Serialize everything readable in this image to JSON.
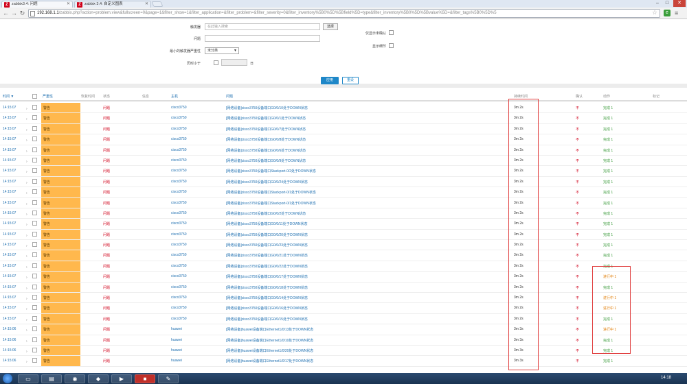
{
  "browser": {
    "tabs": [
      {
        "title": "zabbix3.4: 问题",
        "active": true
      },
      {
        "title": "zabbix 3.4: 自定义图表",
        "active": false
      }
    ],
    "url_host": "192.168.1.1",
    "url_path": "/zabbix.php?action=problem.view&fullscreen=0&page=1&filter_show=1&filter_application=&filter_problem=&filter_severity=0&filter_inventory%5B0%5D%5Bfield%5D=type&filter_inventory%5B0%5D%5Bvalue%5D=&filter_tags%5B0%5D%5"
  },
  "filter": {
    "host_label": "触发器",
    "host_placeholder": "在此输入搜索",
    "select_button": "选择",
    "problem_label": "问题",
    "min_severity_label": "最小的触发器严重性",
    "min_severity_value": "未分类",
    "age_label": "历时小于",
    "age_unit": "日",
    "show_unack_label": "仅显示未确认",
    "show_details_label": "显示细节",
    "apply": "应用",
    "reset": "重设"
  },
  "table": {
    "headers": {
      "time": "时间 ▼",
      "severity": "严重性",
      "recovery": "恢复时间",
      "status": "状态",
      "info": "信息",
      "host": "主机",
      "problem": "问题",
      "duration": "持续时间",
      "ack": "确认",
      "actions": "动作",
      "tags": "标记"
    },
    "rows": [
      {
        "time": "14:15:07",
        "severity": "警告",
        "status": "问题",
        "host": "cisco3750",
        "problem": "[网络设备]cisco3750设备端口G0/0/10处于DOWN状态",
        "duration": "3m 2s",
        "ack": "不",
        "action": "完成 1",
        "warn": false
      },
      {
        "time": "14:15:07",
        "severity": "警告",
        "status": "问题",
        "host": "cisco3750",
        "problem": "[网络设备]cisco3750设备端口G0/0/1处于DOWN状态",
        "duration": "3m 2s",
        "ack": "不",
        "action": "完成 1",
        "warn": false
      },
      {
        "time": "14:15:07",
        "severity": "警告",
        "status": "问题",
        "host": "cisco3750",
        "problem": "[网络设备]cisco3750设备端口G0/0/7处于DOWN状态",
        "duration": "3m 2s",
        "ack": "不",
        "action": "完成 1",
        "warn": false
      },
      {
        "time": "14:15:07",
        "severity": "警告",
        "status": "问题",
        "host": "cisco3750",
        "problem": "[网络设备]cisco3750设备端口G0/0/8处于DOWN状态",
        "duration": "3m 2s",
        "ack": "不",
        "action": "完成 1",
        "warn": false
      },
      {
        "time": "14:15:07",
        "severity": "警告",
        "status": "问题",
        "host": "cisco3750",
        "problem": "[网络设备]cisco3750设备端口G0/0/6处于DOWN状态",
        "duration": "3m 2s",
        "ack": "不",
        "action": "完成 1",
        "warn": false
      },
      {
        "time": "14:15:07",
        "severity": "警告",
        "status": "问题",
        "host": "cisco3750",
        "problem": "[网络设备]cisco3750设备端口G0/0/9处于DOWN状态",
        "duration": "3m 2s",
        "ack": "不",
        "action": "完成 1",
        "warn": false
      },
      {
        "time": "14:15:07",
        "severity": "警告",
        "status": "问题",
        "host": "cisco3750",
        "problem": "[网络设备]cisco3750设备端口Stackport-0/2处于DOWN状态",
        "duration": "3m 2s",
        "ack": "不",
        "action": "完成 1",
        "warn": false
      },
      {
        "time": "14:15:07",
        "severity": "警告",
        "status": "问题",
        "host": "cisco3750",
        "problem": "[网络设备]cisco3750设备端口G0/0/24处于DOWN状态",
        "duration": "3m 2s",
        "ack": "不",
        "action": "完成 1",
        "warn": false
      },
      {
        "time": "14:15:07",
        "severity": "警告",
        "status": "问题",
        "host": "cisco3750",
        "problem": "[网络设备]cisco3750设备端口Stackport-0/1处于DOWN状态",
        "duration": "3m 2s",
        "ack": "不",
        "action": "完成 1",
        "warn": false
      },
      {
        "time": "14:15:07",
        "severity": "警告",
        "status": "问题",
        "host": "cisco3750",
        "problem": "[网络设备]cisco3750设备端口Stackport-0/1处于DOWN状态",
        "duration": "3m 2s",
        "ack": "不",
        "action": "完成 1",
        "warn": false
      },
      {
        "time": "14:15:07",
        "severity": "警告",
        "status": "问题",
        "host": "cisco3750",
        "problem": "[网络设备]cisco3750设备端口G0/0/2处于DOWN状态",
        "duration": "3m 2s",
        "ack": "不",
        "action": "完成 1",
        "warn": false
      },
      {
        "time": "14:15:07",
        "severity": "警告",
        "status": "问题",
        "host": "cisco3750",
        "problem": "[网络设备]cisco3750设备端口G0/0/11处于DOWN状态",
        "duration": "3m 2s",
        "ack": "不",
        "action": "完成 1",
        "warn": false
      },
      {
        "time": "14:15:07",
        "severity": "警告",
        "status": "问题",
        "host": "cisco3750",
        "problem": "[网络设备]cisco3750设备端口G0/0/20处于DOWN状态",
        "duration": "3m 2s",
        "ack": "不",
        "action": "完成 1",
        "warn": false
      },
      {
        "time": "14:15:07",
        "severity": "警告",
        "status": "问题",
        "host": "cisco3750",
        "problem": "[网络设备]cisco3750设备端口G0/0/23处于DOWN状态",
        "duration": "3m 2s",
        "ack": "不",
        "action": "完成 1",
        "warn": false
      },
      {
        "time": "14:15:07",
        "severity": "警告",
        "status": "问题",
        "host": "cisco3750",
        "problem": "[网络设备]cisco3750设备端口G0/0/21处于DOWN状态",
        "duration": "3m 2s",
        "ack": "不",
        "action": "完成 1",
        "warn": false
      },
      {
        "time": "14:15:07",
        "severity": "警告",
        "status": "问题",
        "host": "cisco3750",
        "problem": "[网络设备]cisco3750设备端口G0/0/22处于DOWN状态",
        "duration": "3m 2s",
        "ack": "不",
        "action": "完成 1",
        "warn": false
      },
      {
        "time": "14:15:07",
        "severity": "警告",
        "status": "问题",
        "host": "cisco3750",
        "problem": "[网络设备]cisco3750设备端口G0/0/17处于DOWN状态",
        "duration": "3m 2s",
        "ack": "不",
        "action": "进行中 1",
        "warn": true
      },
      {
        "time": "14:15:07",
        "severity": "警告",
        "status": "问题",
        "host": "cisco3750",
        "problem": "[网络设备]cisco3750设备端口G0/0/18处于DOWN状态",
        "duration": "3m 2s",
        "ack": "不",
        "action": "完成 1",
        "warn": false
      },
      {
        "time": "14:15:07",
        "severity": "警告",
        "status": "问题",
        "host": "cisco3750",
        "problem": "[网络设备]cisco3750设备端口G0/0/14处于DOWN状态",
        "duration": "3m 2s",
        "ack": "不",
        "action": "进行中 1",
        "warn": true
      },
      {
        "time": "14:15:07",
        "severity": "警告",
        "status": "问题",
        "host": "cisco3750",
        "problem": "[网络设备]cisco3750设备端口G0/0/16处于DOWN状态",
        "duration": "3m 2s",
        "ack": "不",
        "action": "进行中 1",
        "warn": true
      },
      {
        "time": "14:15:07",
        "severity": "警告",
        "status": "问题",
        "host": "cisco3750",
        "problem": "[网络设备]cisco3750设备端口G0/0/15处于DOWN状态",
        "duration": "3m 2s",
        "ack": "不",
        "action": "完成 1",
        "warn": false
      },
      {
        "time": "14:15:06",
        "severity": "警告",
        "status": "问题",
        "host": "huawei",
        "problem": "[网络设备]huawei设备端口Ethernet1/0/13处于DOWN状态",
        "duration": "3m 3s",
        "ack": "不",
        "action": "进行中 1",
        "warn": true
      },
      {
        "time": "14:15:06",
        "severity": "警告",
        "status": "问题",
        "host": "huawei",
        "problem": "[网络设备]huawei设备端口Ethernet1/0/10处于DOWN状态",
        "duration": "3m 3s",
        "ack": "不",
        "action": "完成 1",
        "warn": false
      },
      {
        "time": "14:15:06",
        "severity": "警告",
        "status": "问题",
        "host": "huawei",
        "problem": "[网络设备]huawei设备端口Ethernet1/0/20处于DOWN状态",
        "duration": "3m 3s",
        "ack": "不",
        "action": "完成 1",
        "warn": false
      },
      {
        "time": "14:15:06",
        "severity": "警告",
        "status": "问题",
        "host": "huawei",
        "problem": "[网络设备]huawei设备端口Ethernet1/0/17处于DOWN状态",
        "duration": "3m 3s",
        "ack": "不",
        "action": "完成 1",
        "warn": false
      }
    ]
  },
  "taskbar": {
    "clock": "14:18"
  },
  "colors": {
    "severity_warning": "#ffb84d",
    "status_problem": "#d0021b",
    "link": "#1e6fb0",
    "action_done": "#3a9a3a",
    "action_in_progress": "#e07a00",
    "highlight_box": "#e04040"
  }
}
